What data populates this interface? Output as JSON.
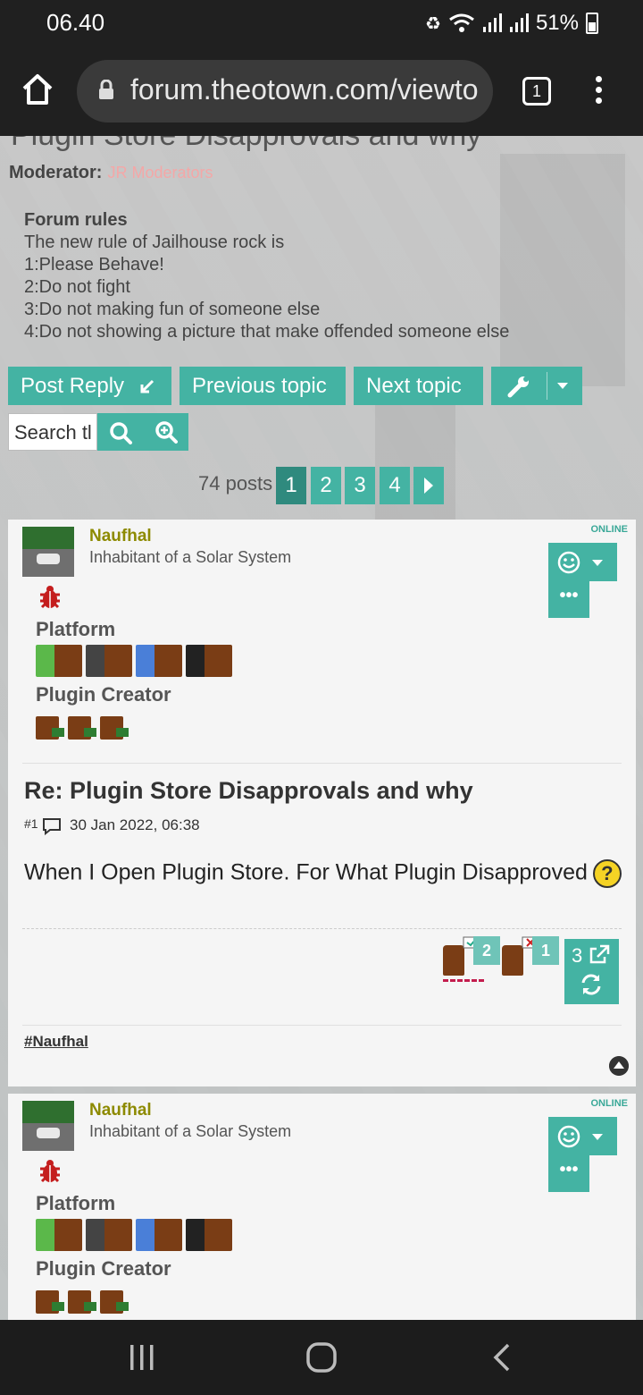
{
  "status_bar": {
    "time": "06.40",
    "battery": "51%"
  },
  "browser": {
    "url": "forum.theotown.com/viewto",
    "tab_count": "1"
  },
  "forum": {
    "title_cut": "Plugin Store Disapprovals and why",
    "moderator_label": "Moderator:",
    "moderators": "JR Moderators",
    "rules_heading": "Forum rules",
    "rules_lines": [
      "The new rule of Jailhouse rock is",
      "1:Please Behave!",
      "2:Do not fight",
      "3:Do not making fun of someone else",
      "4:Do not showing a picture that make offended someone else"
    ],
    "buttons": {
      "post_reply": "Post Reply",
      "previous_topic": "Previous topic",
      "next_topic": "Next topic"
    },
    "search_placeholder": "Search tl",
    "posts_count": "74 posts",
    "pages": [
      "1",
      "2",
      "3",
      "4"
    ],
    "active_page": "1"
  },
  "posts": [
    {
      "username": "Naufhal",
      "rank": "Inhabitant of a Solar System",
      "online": "ONLINE",
      "platform_label": "Platform",
      "plugin_creator_label": "Plugin Creator",
      "title": "Re: Plugin Store Disapprovals and why",
      "post_number": "#1",
      "date": "30 Jan 2022, 06:38",
      "body": "When I Open Plugin Store. For What Plugin Disapproved",
      "approve_count": "2",
      "disapprove_count": "1",
      "share_count": "3",
      "signature": "#Naufhal"
    },
    {
      "username": "Naufhal",
      "rank": "Inhabitant of a Solar System",
      "online": "ONLINE",
      "platform_label": "Platform",
      "plugin_creator_label": "Plugin Creator"
    }
  ],
  "colors": {
    "accent": "#44b3a3",
    "accent_dark": "#2f8a7e",
    "username": "#8d8a00",
    "moderators": "#f4a7a7"
  }
}
